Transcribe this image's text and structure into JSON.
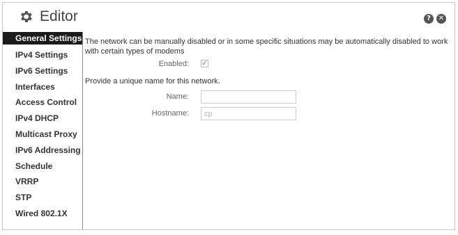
{
  "editor": {
    "title": "Editor",
    "help_symbol": "?",
    "close_symbol": "✕"
  },
  "sidebar": {
    "items": [
      {
        "label": "General Settings",
        "active": true
      },
      {
        "label": "IPv4 Settings"
      },
      {
        "label": "IPv6 Settings"
      },
      {
        "label": "Interfaces"
      },
      {
        "label": "Access Control"
      },
      {
        "label": "IPv4 DHCP"
      },
      {
        "label": "Multicast Proxy"
      },
      {
        "label": "IPv6 Addressing"
      },
      {
        "label": "Schedule"
      },
      {
        "label": "VRRP"
      },
      {
        "label": "STP"
      },
      {
        "label": "Wired 802.1X"
      }
    ]
  },
  "main": {
    "description": "The network can be manually disabled or in some specific situations may be automatically disabled to work with certain types of modems",
    "enabled_label": "Enabled:",
    "enabled_checked": true,
    "checkmark": "✓",
    "name_prompt": "Provide a unique name for this network.",
    "name_label": "Name:",
    "name_value": "",
    "hostname_label": "Hostname:",
    "hostname_placeholder": "cp"
  },
  "colors": {
    "active_bg": "#1b1b1b",
    "active_text": "#ffffff",
    "border": "#8a8a8a",
    "icon": "#555555"
  }
}
